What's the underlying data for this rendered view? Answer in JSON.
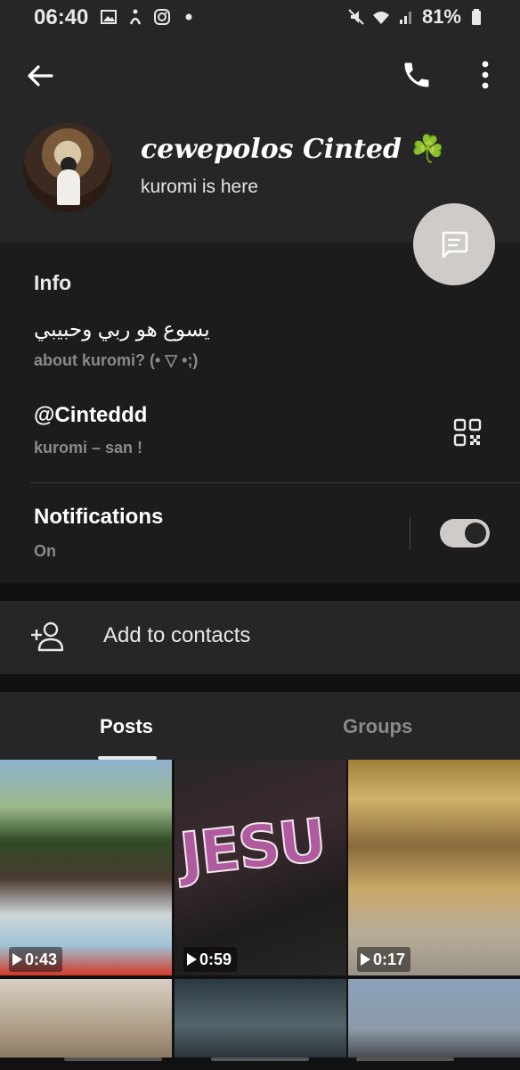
{
  "status_bar": {
    "time": "06:40",
    "battery": "81%",
    "left_icons": [
      "image-icon",
      "accessibility-icon",
      "instagram-icon",
      "dot-icon"
    ],
    "right_icons": [
      "mute-icon",
      "wifi-icon",
      "signal-icon",
      "battery-icon"
    ]
  },
  "header": {
    "profile_name": "cewepolos Cinted",
    "profile_name_emoji": "☘️",
    "profile_status": "kuromi is here"
  },
  "info": {
    "title": "Info",
    "bio": "يسوع هو ربي وحبيبي",
    "bio_label": "about kuromi? (• ▽ •;)",
    "handle": "@Cinteddd",
    "handle_label": "kuromi – san !",
    "notifications_title": "Notifications",
    "notifications_value": "On",
    "notifications_enabled": true
  },
  "add_contacts": {
    "label": "Add to contacts"
  },
  "tabs": {
    "posts": "Posts",
    "groups": "Groups",
    "active": "Posts"
  },
  "posts": [
    {
      "duration": "0:43"
    },
    {
      "duration": "0:59",
      "overlay_text": "JESU"
    },
    {
      "duration": "0:17"
    },
    {},
    {},
    {}
  ],
  "colors": {
    "background": "#1c1c1c",
    "panel": "#262626",
    "accent_light": "#cfcbc8",
    "muted_text": "#8a8a8a"
  }
}
